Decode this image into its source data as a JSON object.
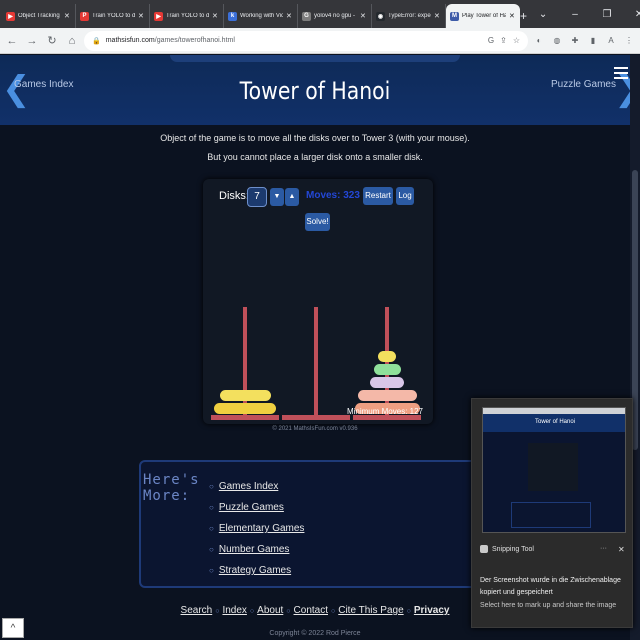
{
  "browser": {
    "tabs": [
      {
        "label": "Object Tracking fr",
        "fav_color": "#e53935",
        "fav_glyph": "▶",
        "active": false
      },
      {
        "label": "Train YOLO to dete",
        "fav_color": "#e53935",
        "fav_glyph": "P",
        "active": false
      },
      {
        "label": "Train YOLO to dete",
        "fav_color": "#e53935",
        "fav_glyph": "▶",
        "active": false
      },
      {
        "label": "Working with Vide",
        "fav_color": "#3b6fd8",
        "fav_glyph": "k",
        "active": false
      },
      {
        "label": "yolov4 no gpu - Go",
        "fav_color": "#7d7d7d",
        "fav_glyph": "G",
        "active": false
      },
      {
        "label": "TypeError: expecte",
        "fav_color": "#24292e",
        "fav_glyph": "◉",
        "active": false
      },
      {
        "label": "Play Tower of Hano",
        "fav_color": "#3e5ba8",
        "fav_glyph": "M",
        "active": true
      }
    ],
    "url_host": "mathsisfun.com",
    "url_path": "/games/towerofhanoi.html"
  },
  "header": {
    "title": "Tower of Hanoi",
    "left_link": "Games Index",
    "right_link": "Puzzle Games"
  },
  "instructions": {
    "line1": "Object of the game is to move all the disks over to Tower 3 (with your mouse).",
    "line2": "But you cannot place a larger disk onto a smaller disk."
  },
  "game": {
    "disks_label": "Disks:",
    "disks_value": "7",
    "down_glyph": "▼",
    "up_glyph": "▲",
    "moves_text": "Moves: 323",
    "restart_label": "Restart",
    "log_label": "Log",
    "solve_label": "Solve!",
    "min_moves": "Minimum Moves: 127",
    "copyright": "© 2021 MathsIsFun.com v0.936",
    "towers": [
      [
        {
          "width": 0.95,
          "color": "#f0d040"
        },
        {
          "width": 0.78,
          "color": "#f3e05e"
        }
      ],
      [],
      [
        {
          "width": 1.0,
          "color": "#ef9f82"
        },
        {
          "width": 0.9,
          "color": "#f4b8a8"
        },
        {
          "width": 0.52,
          "color": "#d9c6e8"
        },
        {
          "width": 0.42,
          "color": "#8fe09a"
        },
        {
          "width": 0.28,
          "color": "#f3e05e"
        }
      ]
    ]
  },
  "more": {
    "title": "Here's More:",
    "links": [
      "Games Index",
      "Puzzle Games",
      "Elementary Games",
      "Number Games",
      "Strategy Games"
    ]
  },
  "footer": {
    "links": [
      "Search",
      "Index",
      "About",
      "Contact",
      "Cite This Page",
      "Privacy"
    ],
    "copyright": "Copyright © 2022 Rod Pierce"
  },
  "toast": {
    "app_name": "Snipping Tool",
    "message": "Der Screenshot wurde in die Zwischenablage kopiert und gespeichert",
    "sub": "Select here to mark up and share the image"
  }
}
